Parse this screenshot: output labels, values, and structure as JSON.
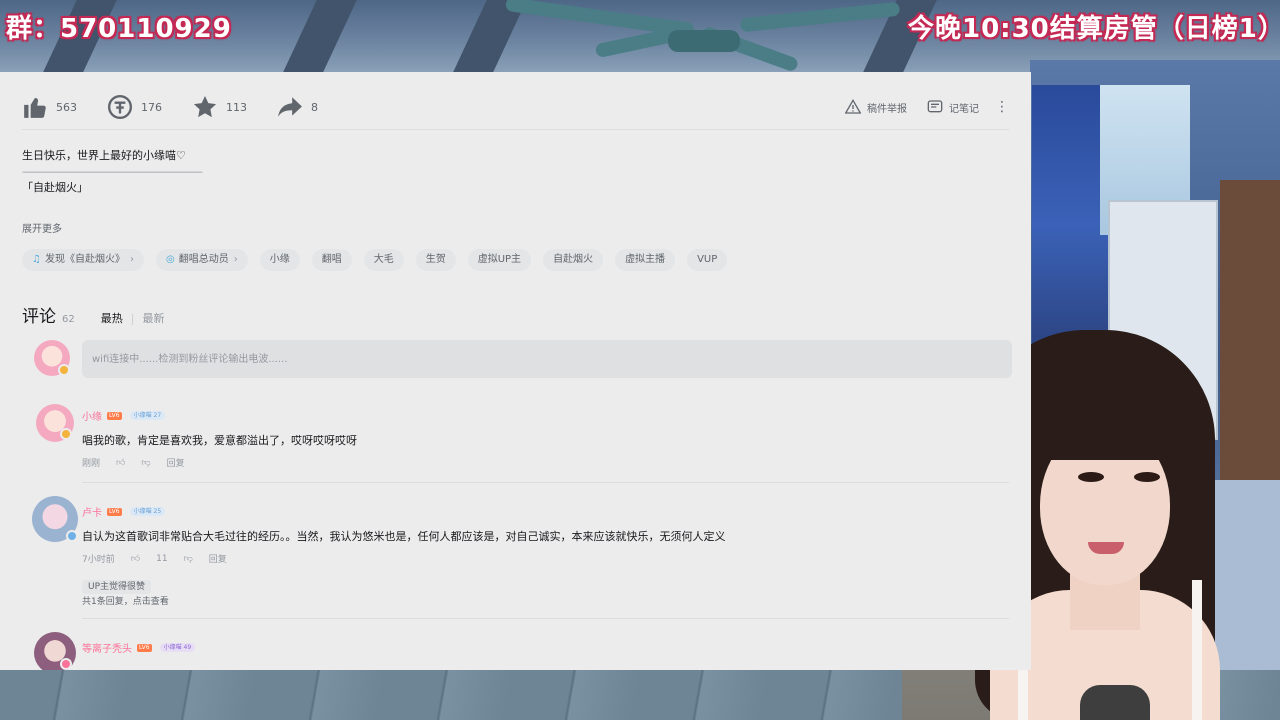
{
  "overlay": {
    "group_text": "群：570110929",
    "announcement": "今晚10:30结算房管（日榜1）"
  },
  "actions": {
    "like_count": "563",
    "coin_count": "176",
    "favorite_count": "113",
    "share_count": "8",
    "report_label": "稿件举报",
    "notes_label": "记笔记"
  },
  "description": {
    "line1": "生日快乐，世界上最好的小缘喵♡",
    "line2": "——————————————————",
    "line3": "「自赴烟火」",
    "expand_label": "展开更多"
  },
  "tags": [
    {
      "label": "发现《自赴烟火》",
      "icon": "music-note-icon"
    },
    {
      "label": "翻唱总动员",
      "icon": "topic-icon"
    },
    {
      "label": "小缘"
    },
    {
      "label": "翻唱"
    },
    {
      "label": "大毛"
    },
    {
      "label": "生贺"
    },
    {
      "label": "虚拟UP主"
    },
    {
      "label": "自赴烟火"
    },
    {
      "label": "虚拟主播"
    },
    {
      "label": "VUP"
    }
  ],
  "comments_section": {
    "title": "评论",
    "count": "62",
    "sort_hot": "最热",
    "sort_new": "最新",
    "input_placeholder": "wifi连接中......检测到粉丝评论输出电波......"
  },
  "comments": [
    {
      "user": "小缘",
      "level": "LV6",
      "fan_badge": "小缘喵 27",
      "text": "唱我的歌，肯定是喜欢我，爱意都溢出了，哎呀哎呀哎呀",
      "time": "刚刚",
      "likes": "",
      "reply": "回复"
    },
    {
      "user": "卢卡",
      "level": "LV6",
      "fan_badge": "小缘喵 25",
      "text": "自认为这首歌词非常贴合大毛过往的经历。。当然，我认为悠米也是，任何人都应该是，对自己诚实，本来应该就快乐，无须何人定义",
      "time": "7小时前",
      "likes": "11",
      "reply": "回复",
      "up_liked": "UP主觉得很赞",
      "sub_replies": "共1条回复，点击查看"
    },
    {
      "user": "等离子秃头",
      "level": "LV6",
      "fan_badge": "小缘喵 49"
    }
  ],
  "colors": {
    "accent_pink": "#fb7299",
    "panel_bg": "#ececed",
    "text_primary": "#18191c",
    "text_secondary": "#61666d",
    "text_muted": "#9499a0",
    "overlay_outline": "#c42a55"
  }
}
